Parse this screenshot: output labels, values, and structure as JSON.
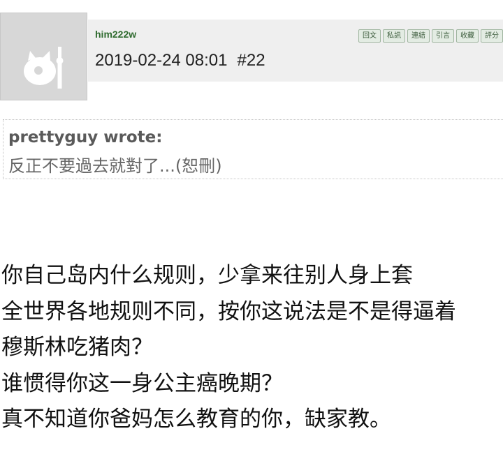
{
  "post": {
    "author": "him222w",
    "datetime": "2019-02-24 08:01",
    "floor": "#22",
    "actions": [
      "回文",
      "私訊",
      "連結",
      "引言",
      "收藏",
      "評分"
    ]
  },
  "quote": {
    "author_line": "prettyguy wrote:",
    "text": "反正不要過去就對了...(恕刪)"
  },
  "body_lines": [
    "你自己岛内什么规则，少拿来往别人身上套",
    "全世界各地规则不同，按你这说法是不是得逼着",
    "穆斯林吃猪肉？",
    "谁惯得你这一身公主癌晚期？",
    "真不知道你爸妈怎么教育的你，缺家教。"
  ]
}
